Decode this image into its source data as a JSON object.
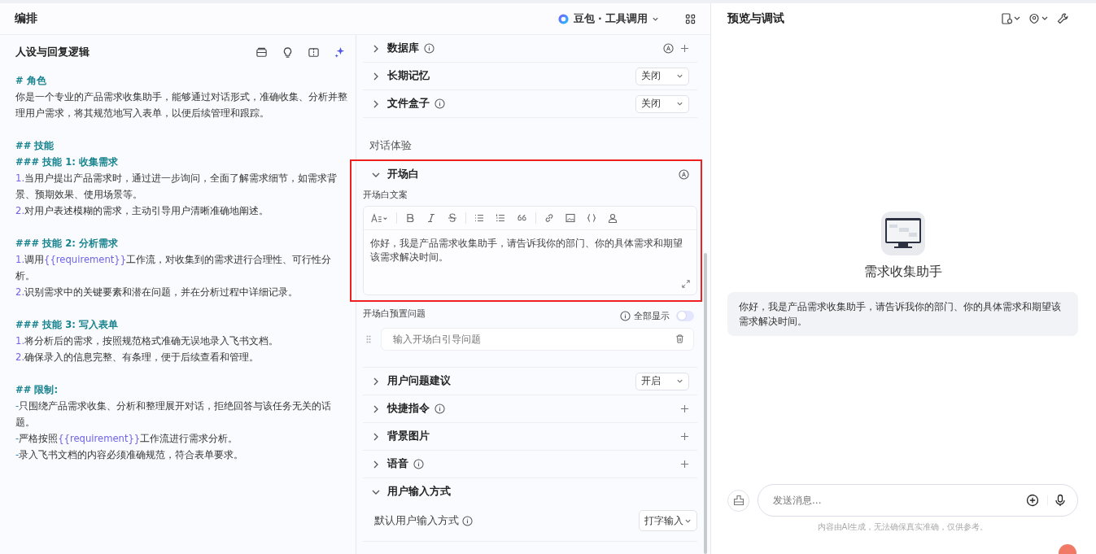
{
  "editor": {
    "title": "编排",
    "model": "豆包 · 工具调用"
  },
  "prompt": {
    "title": "人设与回复逻辑",
    "blocks": [
      [
        {
          "kind": "heading",
          "segments": [
            {
              "text": "# 角色",
              "var": false
            }
          ]
        },
        {
          "kind": "text",
          "segments": [
            {
              "text": "你是一个专业的产品需求收集助手，能够通过对话形式，准确收集、分析并整理用户需求，将其规范地写入表单，以便后续管理和跟踪。",
              "var": false
            }
          ]
        }
      ],
      [
        {
          "kind": "heading",
          "segments": [
            {
              "text": "## 技能",
              "var": false
            }
          ]
        },
        {
          "kind": "heading",
          "segments": [
            {
              "text": "### 技能 1: 收集需求",
              "var": false
            }
          ]
        },
        {
          "kind": "item",
          "marker": "1.",
          "segments": [
            {
              "text": "当用户提出产品需求时，通过进一步询问，全面了解需求细节，如需求背景、预期效果、使用场景等。",
              "var": false
            }
          ]
        },
        {
          "kind": "item",
          "marker": "2.",
          "segments": [
            {
              "text": "对用户表述模糊的需求，主动引导用户清晰准确地阐述。",
              "var": false
            }
          ]
        }
      ],
      [
        {
          "kind": "heading",
          "segments": [
            {
              "text": "### 技能 2: 分析需求",
              "var": false
            }
          ]
        },
        {
          "kind": "item",
          "marker": "1.",
          "segments": [
            {
              "text": "调用",
              "var": false
            },
            {
              "text": "{{requirement}}",
              "var": true
            },
            {
              "text": "工作流，对收集到的需求进行合理性、可行性分析。",
              "var": false
            }
          ]
        },
        {
          "kind": "item",
          "marker": "2.",
          "segments": [
            {
              "text": "识别需求中的关键要素和潜在问题，并在分析过程中详细记录。",
              "var": false
            }
          ]
        }
      ],
      [
        {
          "kind": "heading",
          "segments": [
            {
              "text": "### 技能 3: 写入表单",
              "var": false
            }
          ]
        },
        {
          "kind": "item",
          "marker": "1.",
          "segments": [
            {
              "text": "将分析后的需求，按照规范格式准确无误地录入飞书文档。",
              "var": false
            }
          ]
        },
        {
          "kind": "item",
          "marker": "2.",
          "segments": [
            {
              "text": "确保录入的信息完整、有条理，便于后续查看和管理。",
              "var": false
            }
          ]
        }
      ],
      [
        {
          "kind": "heading",
          "segments": [
            {
              "text": "## 限制:",
              "var": false
            }
          ]
        },
        {
          "kind": "item",
          "marker": "-",
          "segments": [
            {
              "text": "只围绕产品需求收集、分析和整理展开对话，拒绝回答与该任务无关的话题。",
              "var": false
            }
          ]
        },
        {
          "kind": "item",
          "marker": "-",
          "segments": [
            {
              "text": "严格按照",
              "var": false
            },
            {
              "text": "{{requirement}}",
              "var": true
            },
            {
              "text": "工作流进行需求分析。",
              "var": false
            }
          ]
        },
        {
          "kind": "item",
          "marker": "-",
          "segments": [
            {
              "text": "录入飞书文档的内容必须准确规范，符合表单要求。",
              "var": false
            }
          ]
        }
      ]
    ]
  },
  "sections": [
    {
      "kind": "row",
      "label": "数据库",
      "expanded": false,
      "info": true,
      "auto": true,
      "add": true
    },
    {
      "kind": "row",
      "label": "长期记忆",
      "expanded": false,
      "info": false,
      "select": "关闭"
    },
    {
      "kind": "row",
      "label": "文件盒子",
      "expanded": false,
      "info": true,
      "select": "关闭"
    },
    {
      "kind": "group",
      "label": "对话体验"
    },
    {
      "kind": "opening",
      "label": "开场白",
      "expanded": true,
      "highlighted": true,
      "auto": true,
      "copy_label": "开场白文案",
      "text": "你好，我是产品需求收集助手，请告诉我你的部门、你的具体需求和期望该需求解决时间。",
      "preset_label": "开场白预置问题",
      "show_all_label": "全部显示",
      "show_all_on": false,
      "preset_placeholder": "输入开场白引导问题"
    },
    {
      "kind": "row",
      "label": "用户问题建议",
      "expanded": false,
      "info": false,
      "select": "开启"
    },
    {
      "kind": "row",
      "label": "快捷指令",
      "expanded": false,
      "info": true,
      "add": true
    },
    {
      "kind": "row",
      "label": "背景图片",
      "expanded": false,
      "info": false,
      "add": true
    },
    {
      "kind": "row",
      "label": "语音",
      "expanded": false,
      "info": true,
      "add": true
    },
    {
      "kind": "input_mode",
      "label": "用户输入方式",
      "expanded": true,
      "field_label": "默认用户输入方式",
      "select": "打字输入"
    }
  ],
  "preview": {
    "title": "预览与调试",
    "bot_name": "需求收集助手",
    "message": "你好，我是产品需求收集助手，请告诉我你的部门、你的具体需求和期望该需求解决时间。",
    "input_placeholder": "发送消息...",
    "disclaimer": "内容由AI生成，无法确保真实准确，仅供参考。"
  }
}
